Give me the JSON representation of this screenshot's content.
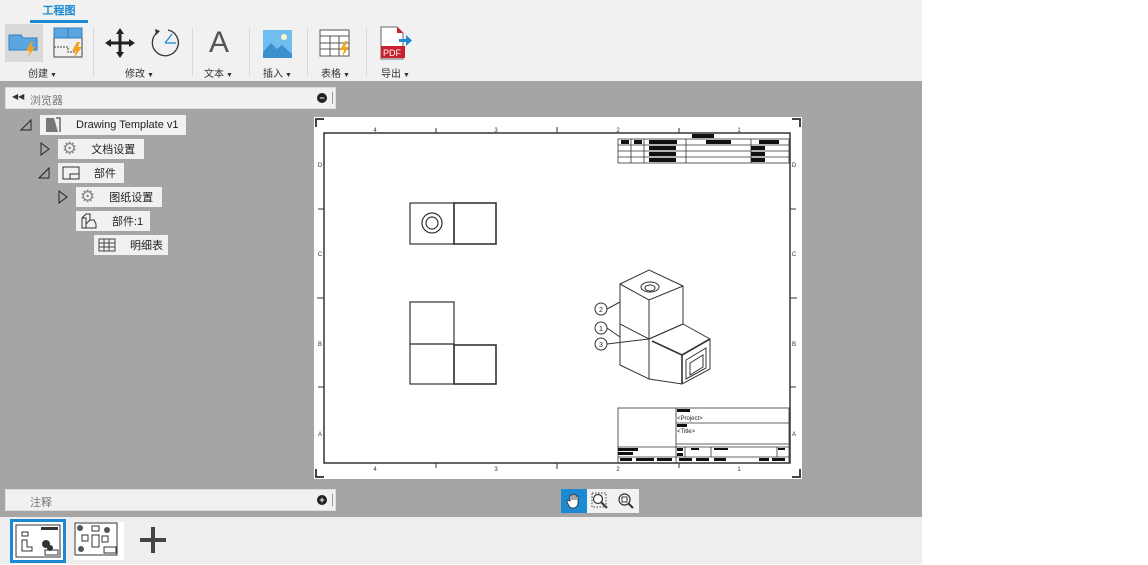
{
  "ribbon": {
    "active_tab": "工程图",
    "groups": [
      {
        "label": "创建",
        "tools": [
          "base-view-icon",
          "projected-view-icon"
        ]
      },
      {
        "label": "修改",
        "tools": [
          "move-icon",
          "rotate-icon"
        ]
      },
      {
        "label": "文本",
        "tools": [
          "text-icon"
        ]
      },
      {
        "label": "插入",
        "tools": [
          "image-icon"
        ]
      },
      {
        "label": "表格",
        "tools": [
          "table-icon"
        ]
      },
      {
        "label": "导出",
        "tools": [
          "pdf-export-icon"
        ]
      }
    ],
    "text_icon_glyph": "A",
    "pdf_label": "PDF"
  },
  "browser": {
    "title": "浏览器",
    "items": [
      {
        "label": "Drawing Template v1",
        "expanded": true
      },
      {
        "label": "文档设置",
        "expanded": false
      },
      {
        "label": "部件",
        "expanded": true
      },
      {
        "label": "图纸设置",
        "expanded": false
      },
      {
        "label": "部件:1"
      },
      {
        "label": "明细表"
      }
    ]
  },
  "annotations_panel": {
    "title": "注释"
  },
  "sheet": {
    "column_labels_top": [
      "4",
      "3",
      "2",
      "1"
    ],
    "column_labels_bottom": [
      "4",
      "3",
      "2",
      "1"
    ],
    "row_labels": [
      "D",
      "C",
      "B",
      "A"
    ],
    "title_block": {
      "project": "<Project>",
      "title": "<Title>"
    },
    "balloons": [
      "2",
      "1",
      "3"
    ]
  },
  "view_controls": {
    "items": [
      "pan",
      "zoom-window",
      "zoom-fit"
    ],
    "active": "pan"
  },
  "sheets": {
    "count": 2,
    "active_index": 0,
    "add_label": "+"
  },
  "colors": {
    "accent": "#1b8ad3",
    "canvas_bg": "#a5a5a5",
    "panel_bg": "#f1f1f1"
  }
}
